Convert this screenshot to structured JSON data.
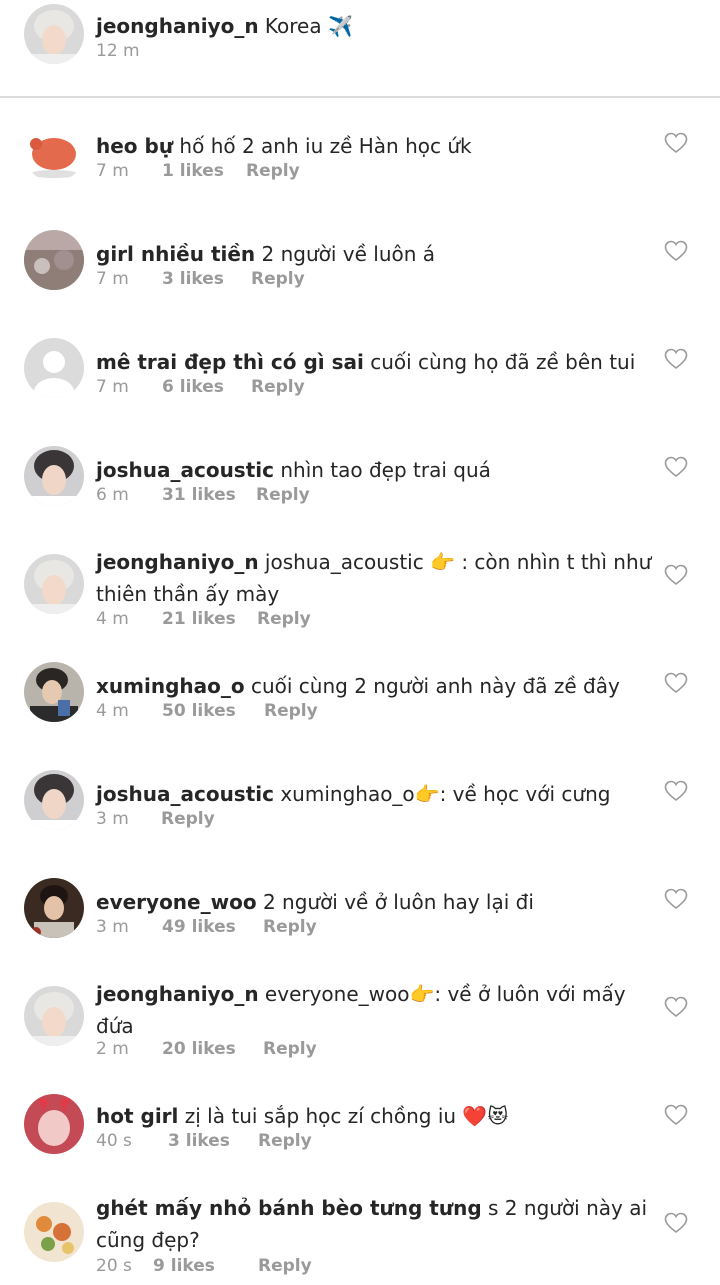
{
  "post": {
    "username": "jeonghaniyo_n",
    "caption": "Korea ✈️",
    "time": "12 m"
  },
  "comments": [
    {
      "username": "heo bự",
      "text": "hố hố 2 anh iu zề Hàn học ứk",
      "time": "7 m",
      "likes": "1 likes",
      "reply": "Reply"
    },
    {
      "username": "girl nhiều tiền",
      "text": "2 người về luôn á",
      "time": "7 m",
      "likes": "3 likes",
      "reply": "Reply"
    },
    {
      "username": "mê trai đẹp thì có gì sai",
      "text": "cuối cùng họ đã zề bên tui",
      "time": "7 m",
      "likes": "6 likes",
      "reply": "Reply"
    },
    {
      "username": "joshua_acoustic",
      "text": "nhìn tao đẹp trai quá",
      "time": "6 m",
      "likes": "31 likes",
      "reply": "Reply"
    },
    {
      "username": "jeonghaniyo_n",
      "text": "joshua_acoustic 👉 : còn nhìn t thì như thiên thần ấy mày",
      "time": "4 m",
      "likes": "21 likes",
      "reply": "Reply"
    },
    {
      "username": "xuminghao_o",
      "text": "cuối cùng 2 người anh này đã zề đây",
      "time": "4 m",
      "likes": "50 likes",
      "reply": "Reply"
    },
    {
      "username": "joshua_acoustic",
      "text": "xuminghao_o👉: về học với cưng",
      "time": "3 m",
      "likes": "",
      "reply": "Reply"
    },
    {
      "username": "everyone_woo",
      "text": "2 người về ở luôn hay lại đi",
      "time": "3 m",
      "likes": "49 likes",
      "reply": "Reply"
    },
    {
      "username": "jeonghaniyo_n",
      "text": "everyone_woo👉: về ở luôn với mấy đứa",
      "time": "2 m",
      "likes": "20 likes",
      "reply": "Reply"
    },
    {
      "username": "hot girl",
      "text": "zị là tui sắp học zí chồng iu ❤️😻",
      "time": "40 s",
      "likes": "3 likes",
      "reply": "Reply"
    },
    {
      "username": "ghét mấy nhỏ bánh bèo tưng tưng",
      "text": "s 2 người này ai cũng đẹp?",
      "time": "20 s",
      "likes": "9 likes",
      "reply": "Reply"
    }
  ]
}
